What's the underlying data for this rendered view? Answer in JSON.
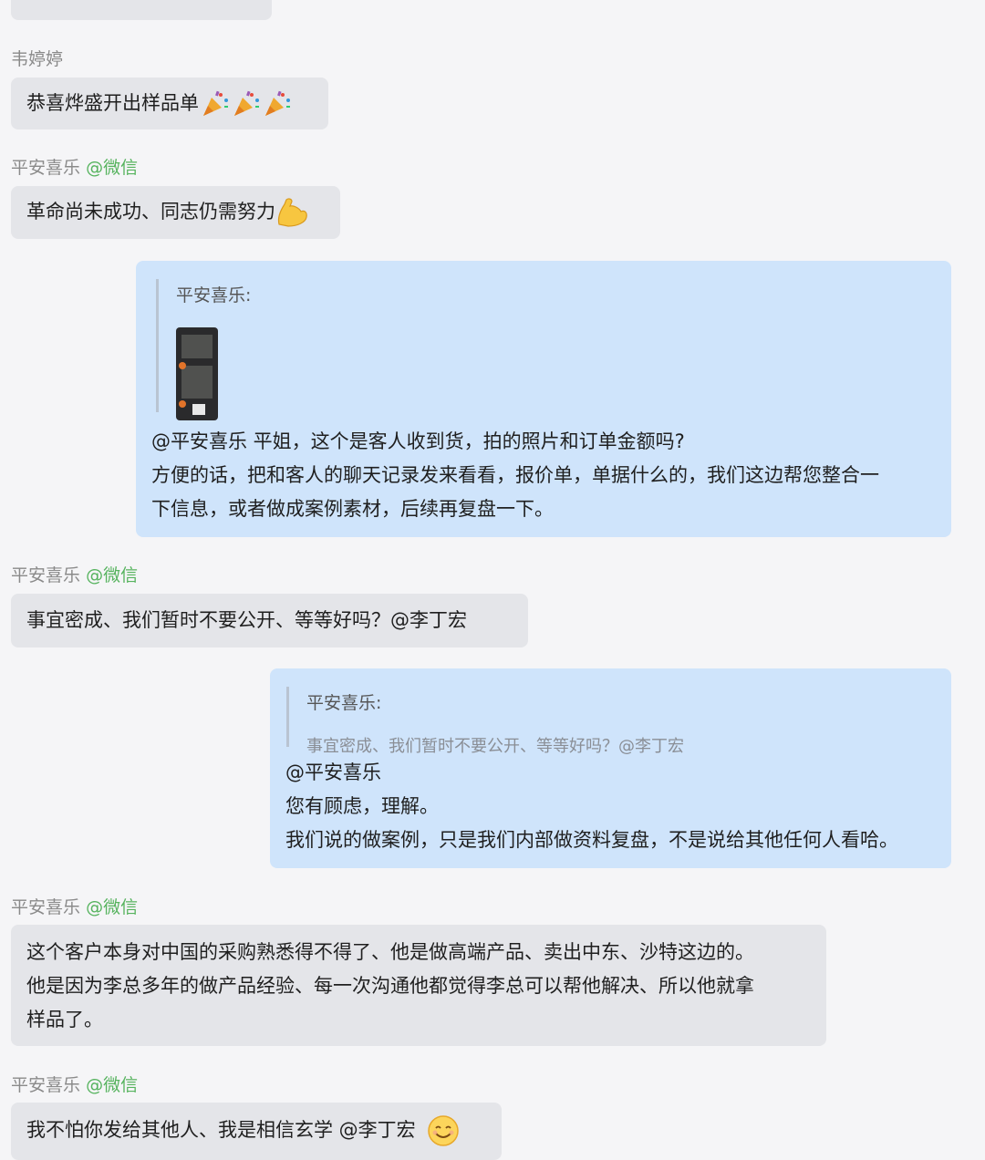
{
  "messages": [
    {
      "sender": "韦婷婷",
      "text": "恭喜烨盛开出样品单"
    },
    {
      "sender": "平安喜乐",
      "via": "@微信",
      "text": "革命尚未成功、同志仍需努力"
    },
    {
      "quote_name": "平安喜乐:",
      "lines": [
        "@平安喜乐 平姐，这个是客人收到货，拍的照片和订单金额吗?",
        "方便的话，把和客人的聊天记录发来看看，报价单，单据什么的，我们这边帮您整合一",
        "下信息，或者做成案例素材，后续再复盘一下。"
      ]
    },
    {
      "sender": "平安喜乐",
      "via": "@微信",
      "text": "事宜密成、我们暂时不要公开、等等好吗？@李丁宏"
    },
    {
      "quote_name": "平安喜乐:",
      "quote_text": "事宜密成、我们暂时不要公开、等等好吗？@李丁宏",
      "lines": [
        "@平安喜乐",
        "您有顾虑，理解。",
        "我们说的做案例，只是我们内部做资料复盘，不是说给其他任何人看哈。"
      ]
    },
    {
      "sender": "平安喜乐",
      "via": "@微信",
      "lines": [
        "这个客户本身对中国的采购熟悉得不得了、他是做高端产品、卖出中东、沙特这边的。",
        "他是因为李总多年的做产品经验、每一次沟通他都觉得李总可以帮他解决、所以他就拿",
        "样品了。"
      ]
    },
    {
      "sender": "平安喜乐",
      "via": "@微信",
      "text": "我不怕你发给其他人、我是相信玄学 @李丁宏"
    }
  ],
  "icons": [
    "party-popper-icon",
    "flexed-biceps-icon",
    "smiling-face-icon"
  ]
}
